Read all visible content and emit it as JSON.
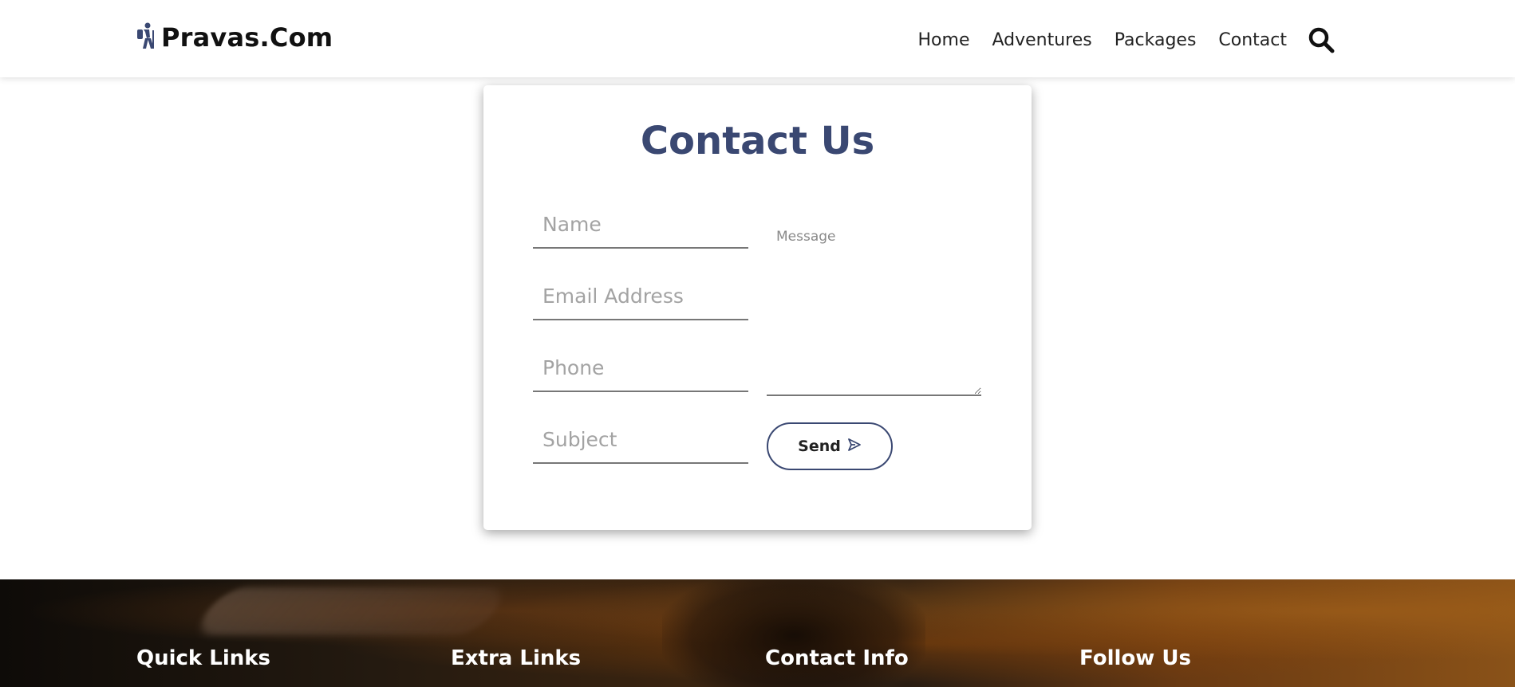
{
  "header": {
    "brand": "Pravas.Com",
    "nav": [
      "Home",
      "Adventures",
      "Packages",
      "Contact"
    ]
  },
  "contact": {
    "title": "Contact Us",
    "name_placeholder": "Name",
    "email_placeholder": "Email Address",
    "phone_placeholder": "Phone",
    "subject_placeholder": "Subject",
    "message_placeholder": "Message",
    "send_label": "Send"
  },
  "footer": {
    "headings": [
      "Quick Links",
      "Extra Links",
      "Contact Info",
      "Follow Us"
    ]
  },
  "colors": {
    "accent": "#3a4872"
  },
  "icons": {
    "logo": "hiker-icon",
    "search": "search-icon",
    "send": "send-icon"
  }
}
